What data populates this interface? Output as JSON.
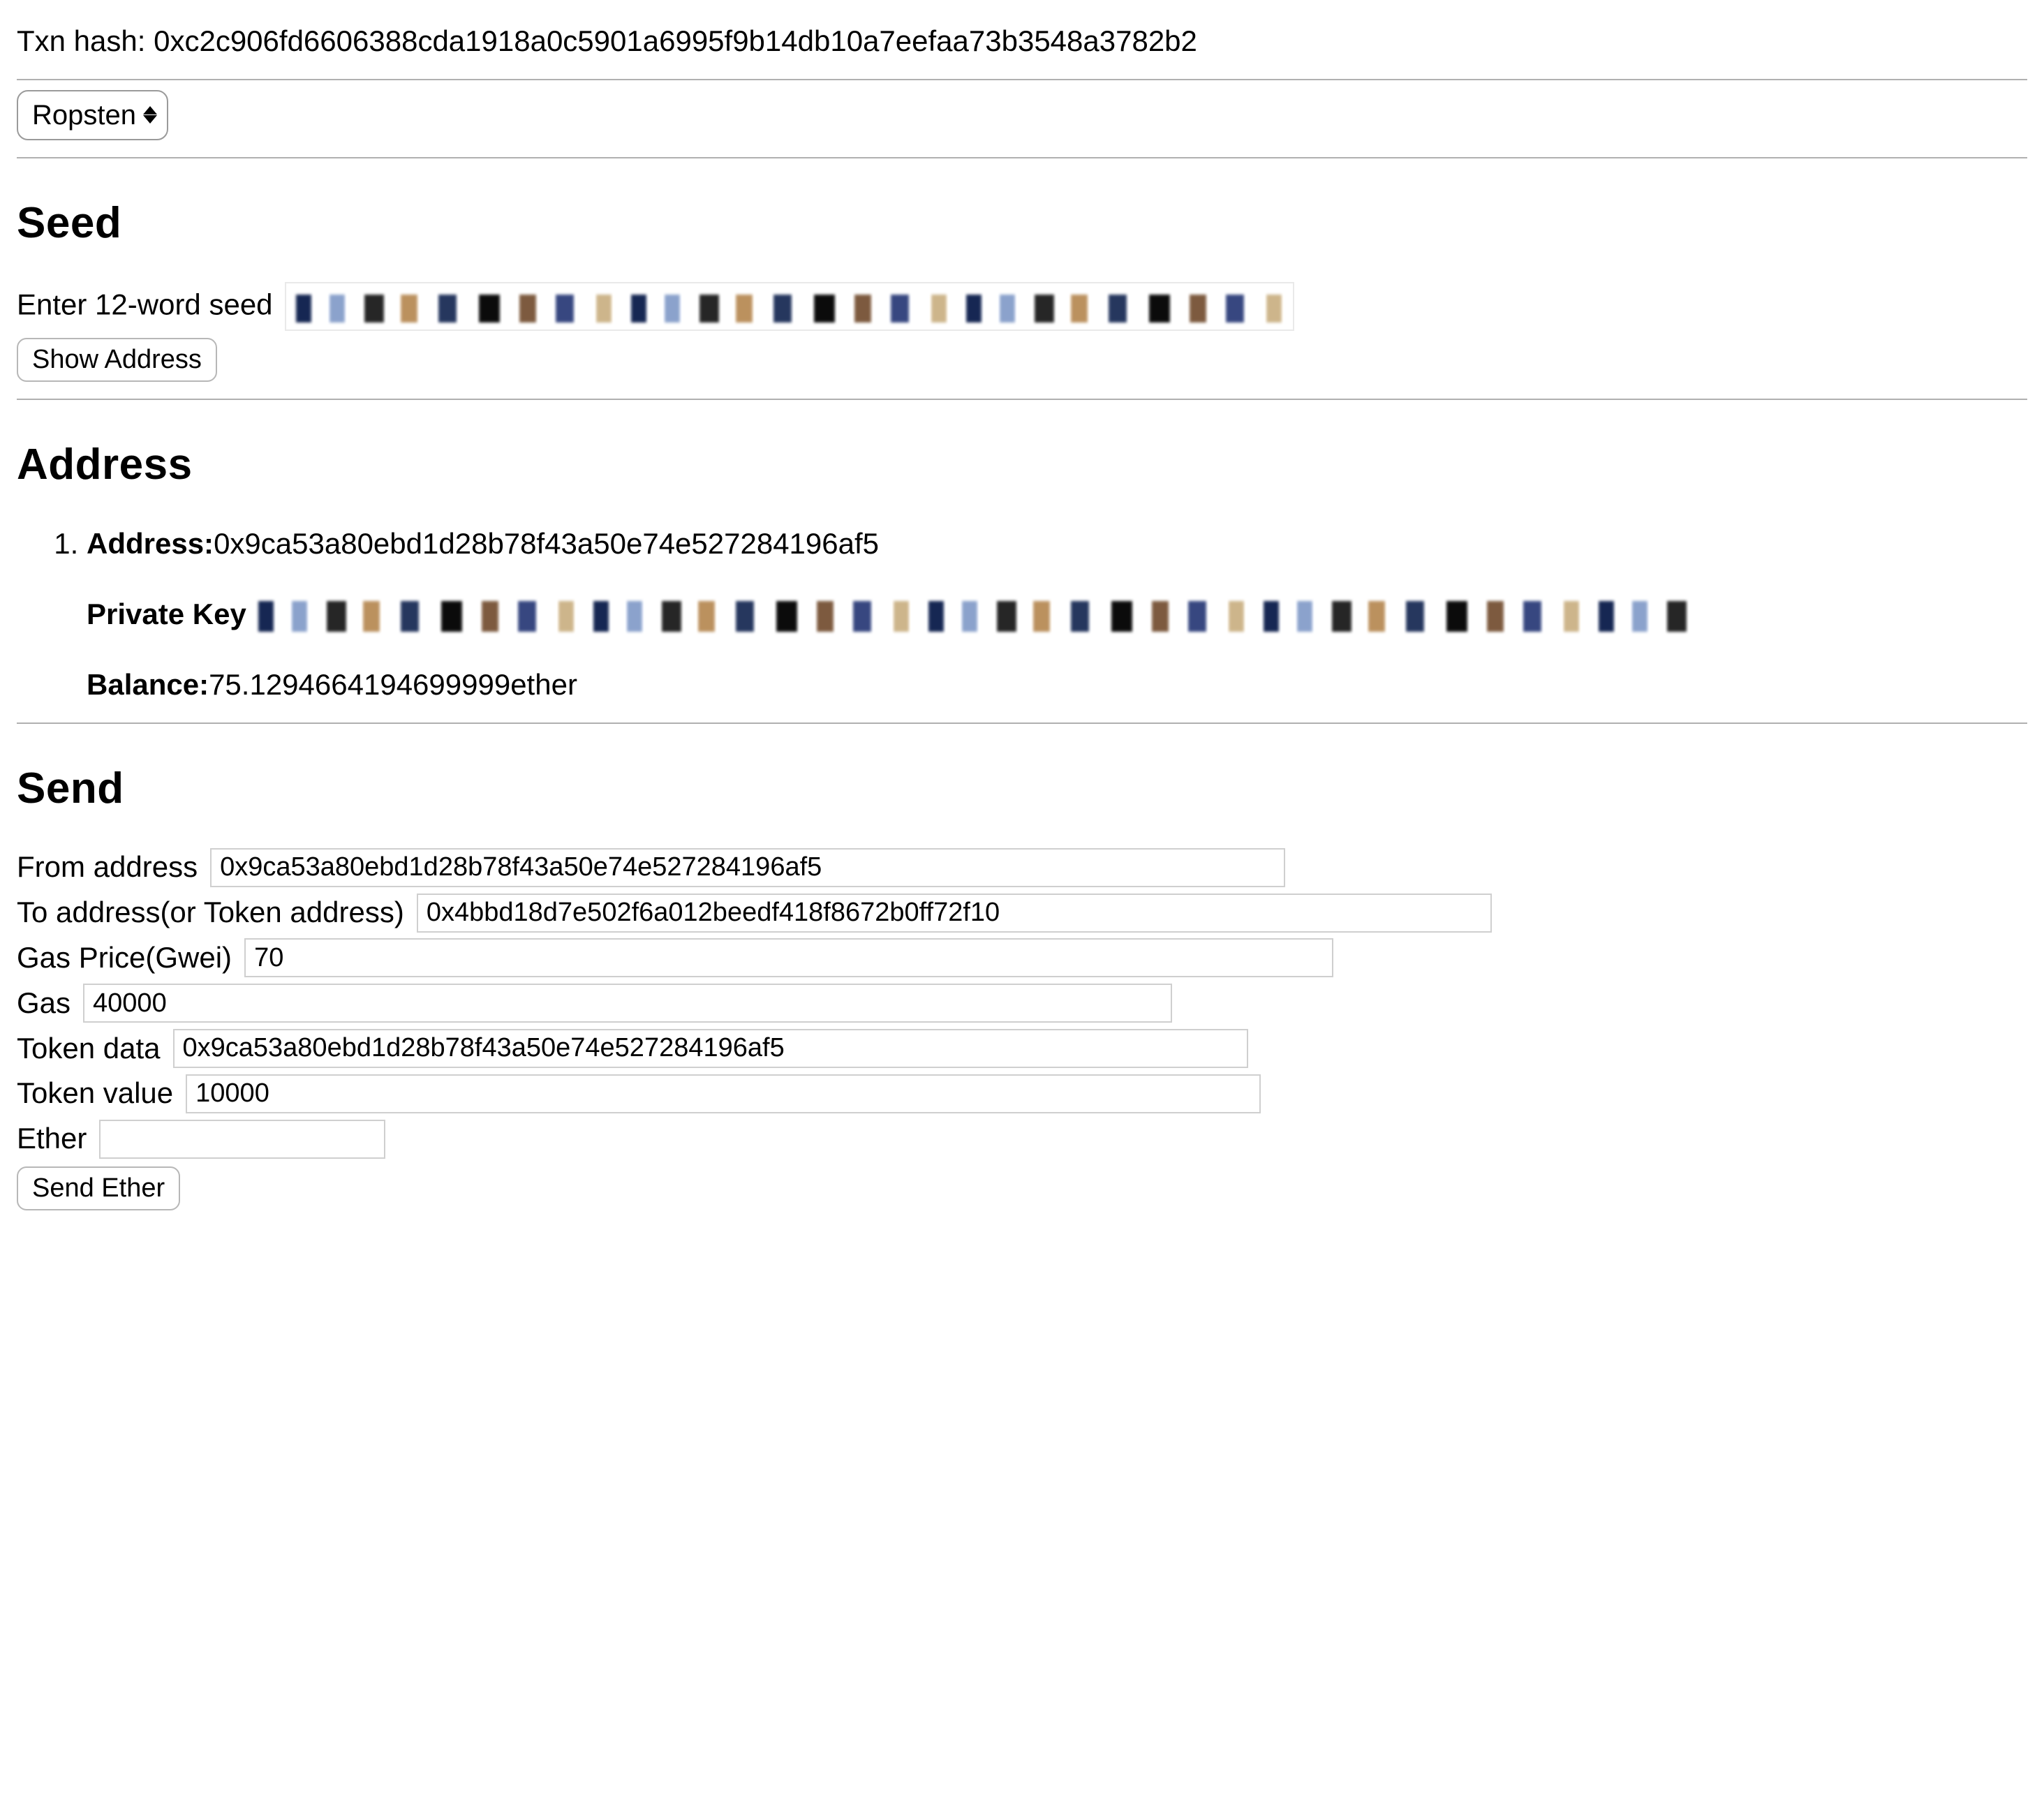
{
  "txn": {
    "label": "Txn hash: ",
    "value": "0xc2c906fd6606388cda1918a0c5901a6995f9b14db10a7eefaa73b3548a3782b2"
  },
  "network": {
    "selected": "Ropsten"
  },
  "seed": {
    "heading": "Seed",
    "input_label": "Enter 12-word seed",
    "value_hidden": true,
    "show_button": "Show Address"
  },
  "address": {
    "heading": "Address",
    "items": [
      {
        "address_label": "Address:",
        "address_value": "0x9ca53a80ebd1d28b78f43a50e74e527284196af5",
        "pk_label": "Private Key",
        "pk_hidden": true,
        "balance_label": "Balance:",
        "balance_value": "75.1294664194699999",
        "balance_unit": "ether"
      }
    ]
  },
  "send": {
    "heading": "Send",
    "from": {
      "label": "From address",
      "value": "0x9ca53a80ebd1d28b78f43a50e74e527284196af5"
    },
    "to": {
      "label": "To address(or Token address)",
      "value": "0x4bbd18d7e502f6a012beedf418f8672b0ff72f10"
    },
    "gas_price": {
      "label": "Gas Price(Gwei)",
      "value": "70"
    },
    "gas": {
      "label": "Gas",
      "value": "40000"
    },
    "token_data": {
      "label": "Token data",
      "value": "0x9ca53a80ebd1d28b78f43a50e74e527284196af5"
    },
    "token_value": {
      "label": "Token value",
      "value": "10000"
    },
    "ether": {
      "label": "Ether",
      "value": ""
    },
    "send_button": "Send Ether"
  }
}
